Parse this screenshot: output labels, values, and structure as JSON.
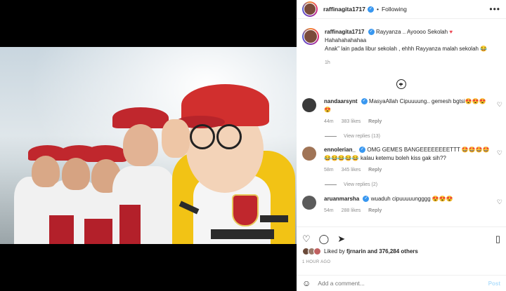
{
  "post": {
    "username": "raffinagita1717",
    "follow_status": "Following",
    "more_label": "•••"
  },
  "caption": {
    "username": "raffinagita1717",
    "line1": "Rayyanza .. Ayoooo Sekolah",
    "line2": "Hahahahahahaa",
    "line3": "Anak\" lain pada libur sekolah , ehhh Rayyanza malah sekolah 😂",
    "time": "1h"
  },
  "comments": [
    {
      "username": "nandaarsynt",
      "text": "MasyaAllah Cipuuuung.. gemesh bgtsi😍😍😍😍",
      "time": "44m",
      "likes": "383 likes",
      "reply_label": "Reply",
      "view_replies": "View replies (13)"
    },
    {
      "username": "ennolerian_",
      "text": "OMG GEMES BANGEEEEEEEETTT 🤩🤩🤩🤩 😂😂😂😂😂 kalau ketemu boleh kiss gak sih??",
      "time": "58m",
      "likes": "345 likes",
      "reply_label": "Reply",
      "view_replies": "View replies (2)"
    },
    {
      "username": "aruanmarsha",
      "text": "wuaduh cipuuuuungggg 😍😍😍",
      "time": "54m",
      "likes": "288 likes",
      "reply_label": "Reply"
    }
  ],
  "likes_summary": {
    "prefix": "Liked by",
    "user": "fjrnarin",
    "rest": "and 376,284 others"
  },
  "timestamp": "1 HOUR AGO",
  "comment_input": {
    "placeholder": "Add a comment...",
    "post_label": "Post"
  },
  "colors": {
    "verified": "#3897f0",
    "heart": "#ed4956",
    "post_disabled": "#b2dffc"
  },
  "icons": [
    "verified-icon",
    "more-icon",
    "add-comment-icon",
    "heart-icon",
    "comment-icon",
    "share-icon",
    "bookmark-icon",
    "emoji-icon"
  ]
}
